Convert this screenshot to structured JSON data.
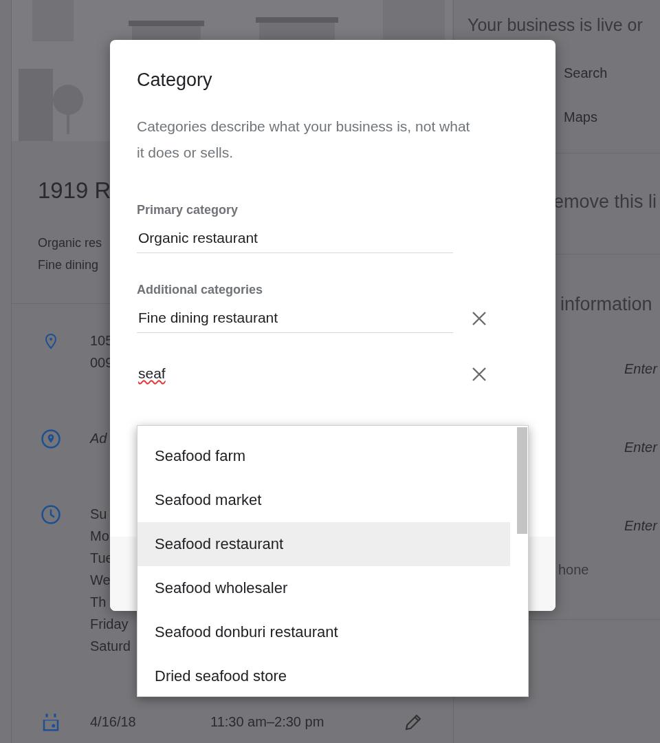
{
  "background_page": {
    "title": "1919 R",
    "categories": [
      "Organic res",
      "Fine dining"
    ],
    "info_rows": [
      {
        "kind": "address",
        "lines": [
          "105",
          "009"
        ]
      },
      {
        "kind": "service_area",
        "lines": [
          "Ad"
        ]
      },
      {
        "kind": "hours",
        "lines": [
          "Su",
          "Mo",
          "Tue",
          "We",
          "Th",
          "Friday",
          "Saturd"
        ]
      },
      {
        "kind": "special_hours",
        "lines": [
          "4/16/18"
        ],
        "time": "11:30 am–2:30 pm"
      }
    ],
    "side_panel": {
      "heading": "Your business is live or",
      "links": [
        "Search",
        "Maps"
      ],
      "remove": "emove this li",
      "info_heading": "information",
      "enter_prompts": [
        "Enter",
        "Enter",
        "Enter"
      ],
      "phone_label": "hone"
    }
  },
  "dialog": {
    "title": "Category",
    "description": "Categories describe what your business is, not what it does or sells.",
    "primary_label": "Primary category",
    "primary_value": "Organic restaurant",
    "additional_label": "Additional categories",
    "additional": [
      {
        "value": "Fine dining restaurant",
        "spelling_error": false
      },
      {
        "value": "seaf",
        "spelling_error": true
      }
    ]
  },
  "suggestions": [
    {
      "label": "Seafood farm",
      "selected": false
    },
    {
      "label": "Seafood market",
      "selected": false
    },
    {
      "label": "Seafood restaurant",
      "selected": true
    },
    {
      "label": "Seafood wholesaler",
      "selected": false
    },
    {
      "label": "Seafood donburi restaurant",
      "selected": false
    },
    {
      "label": "Dried seafood store",
      "selected": false
    }
  ]
}
